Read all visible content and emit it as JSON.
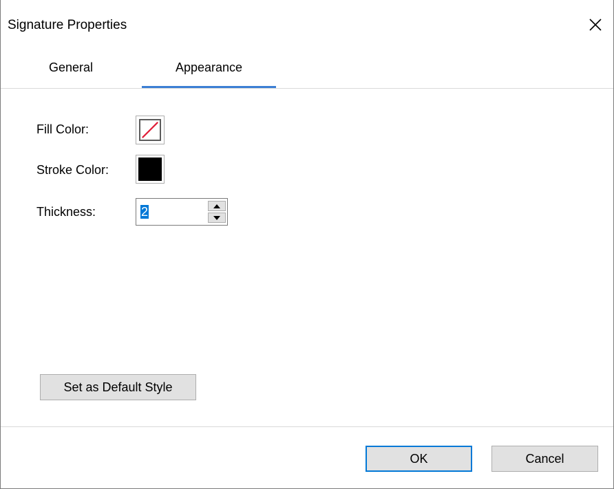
{
  "dialog": {
    "title": "Signature Properties",
    "close_icon": "close-icon"
  },
  "tabs": [
    {
      "label": "General",
      "active": false
    },
    {
      "label": "Appearance",
      "active": true
    }
  ],
  "appearance": {
    "fill_color_label": "Fill Color:",
    "fill_color": "none",
    "stroke_color_label": "Stroke Color:",
    "stroke_color": "#000000",
    "thickness_label": "Thickness:",
    "thickness_value": "2"
  },
  "buttons": {
    "set_default_style": "Set as Default Style",
    "ok": "OK",
    "cancel": "Cancel"
  },
  "colors": {
    "accent": "#3c7fd4",
    "no_fill_slash": "#e0203a"
  }
}
